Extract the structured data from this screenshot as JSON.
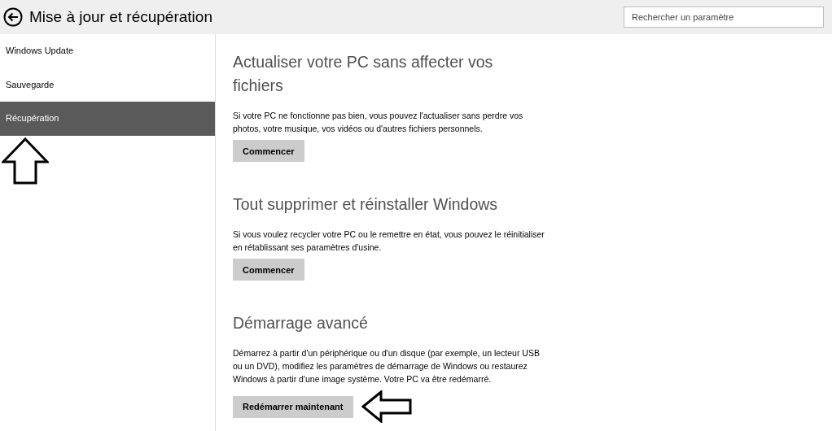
{
  "header": {
    "title": "Mise à jour et récupération",
    "search": {
      "placeholder": "Rechercher un paramètre"
    }
  },
  "sidebar": {
    "items": [
      {
        "label": "Windows Update",
        "selected": false
      },
      {
        "label": "Sauvegarde",
        "selected": false
      },
      {
        "label": "Récupération",
        "selected": true
      }
    ]
  },
  "sections": [
    {
      "title": "Actualiser votre PC sans affecter vos fichiers",
      "description": "Si votre PC ne fonctionne pas bien, vous pouvez l'actualiser sans perdre vos photos, votre musique, vos vidéos ou d'autres fichiers personnels.",
      "button": "Commencer"
    },
    {
      "title": "Tout supprimer et réinstaller Windows",
      "description": "Si vous voulez recycler votre PC ou le remettre en état, vous pouvez le réinitialiser en rétablissant ses paramètres d'usine.",
      "button": "Commencer"
    },
    {
      "title": "Démarrage avancé",
      "description": "Démarrez à partir d'un périphérique ou d'un disque (par exemple, un lecteur USB ou un DVD), modifiez les paramètres de démarrage de Windows ou restaurez Windows à partir d'une image système. Votre PC va être redémarré.",
      "button": "Redémarrer maintenant"
    }
  ]
}
